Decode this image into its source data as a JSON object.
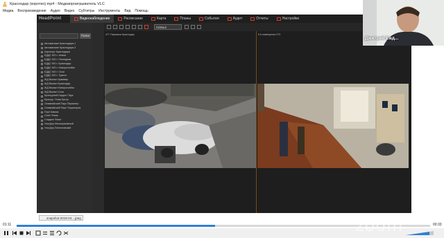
{
  "vlc": {
    "window_title": "Краснодар (коротко).mp4 - Медиапроигрыватель VLC",
    "menu": [
      "Медиа",
      "Воспроизведение",
      "Аудио",
      "Видео",
      "Субтитры",
      "Инструменты",
      "Вид",
      "Помощь"
    ],
    "time_elapsed": "01:11",
    "time_total": "00:33",
    "progress": 0.48
  },
  "headpoint": {
    "logo": "HeadPoint",
    "tabs": [
      "Видеонаблюдение",
      "Расписание",
      "Карта",
      "Планы",
      "События",
      "Аудит",
      "Отчеты",
      "Настройки"
    ],
    "search_button": "Поиск",
    "group_select": "Связь2",
    "cameras": [
      "Автомагазин Краснодара-1",
      "Автомагазин Краснодара-2",
      "Аэропорт Краснодара",
      "ЕДДС МО г. Анапа",
      "ЕДДС МО г. Геленджик",
      "ЕДДС МО г. Краснодар",
      "ЕДДС МО г. Новороссийск",
      "ЕДДС МО г. Сочи",
      "ЕДДС МО г. Туапсе",
      "ЖД Вокзал Армавир",
      "ЖД Вокзал Краснодар",
      "ЖД Вокзал Новороссийск",
      "ЖД Вокзал Сочи",
      "Культурный Гарден Парк",
      "Культур. Пляж Бутор",
      "Олимпийский Парк Периметр",
      "Олимпийский Парк Территория",
      "Порт Кавказ",
      "Сити Плаза",
      "Стадион Фишт",
      "УльтДор Мелиоративный",
      "УльтДор Платоновский"
    ],
    "cam1_label": "477 Парковка Краснодар",
    "cam2_label": "5 в помещении 073",
    "download_file": "snapshot-2019-04....jpeg"
  },
  "zoom": {
    "participant_name": "Дмитрий Евд...",
    "watermark": "zoom"
  },
  "colors": {
    "accent": "#2f7fd6",
    "app_bg": "#2b2b2b",
    "tab_icon": "#d04030"
  }
}
